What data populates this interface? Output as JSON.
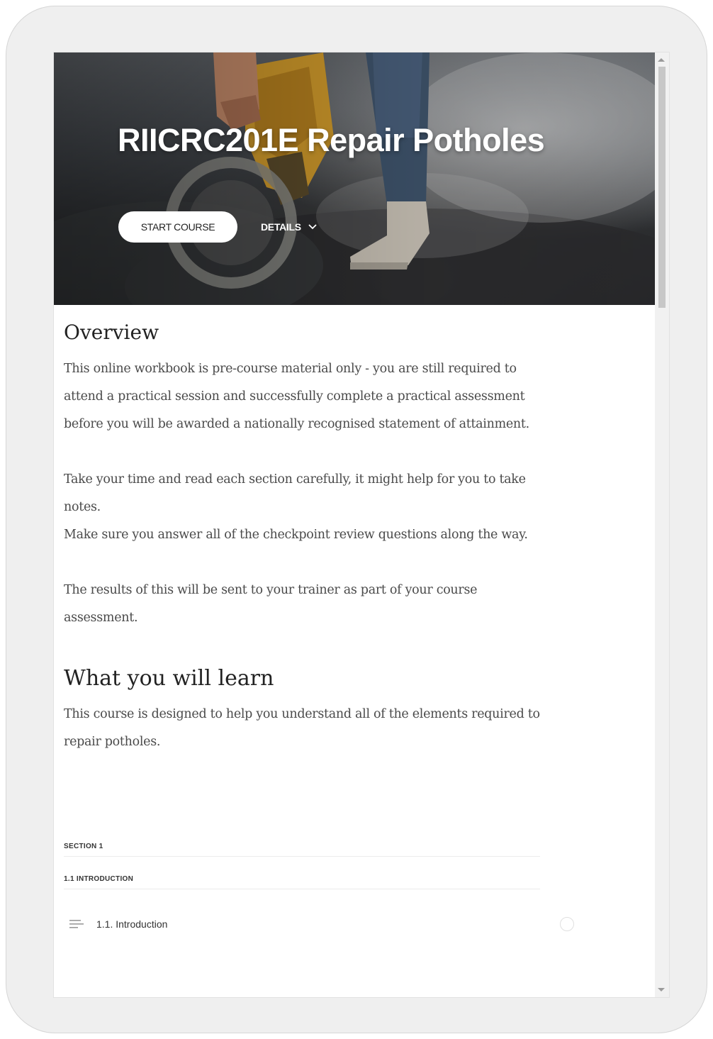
{
  "course": {
    "title": "RIICRC201E Repair Potholes",
    "start_label": "START COURSE",
    "details_label": "DETAILS"
  },
  "overview": {
    "heading": "Overview",
    "paragraphs": [
      "This online workbook is pre-course material only - you are still required to attend a practical session and successfully complete a practical assessment before you will be awarded a nationally recognised statement of attainment.",
      "Take your time and read each section carefully, it might help for you to take notes.",
      "Make sure you answer all of the checkpoint review questions along the way.",
      "The results of this will be sent to your trainer as part of your course assessment."
    ]
  },
  "learn": {
    "heading": "What you will learn",
    "text": "This course is designed to help you understand all of the elements required to repair potholes."
  },
  "outline": {
    "section_label": "SECTION 1",
    "subsection_label": "1.1 INTRODUCTION",
    "lessons": [
      {
        "label": "1.1. Introduction",
        "icon": "text-lines-icon",
        "status": "not-started"
      }
    ]
  },
  "colors": {
    "hero_text": "#ffffff",
    "body_text": "#4a4a4a",
    "frame": "#efefef"
  }
}
